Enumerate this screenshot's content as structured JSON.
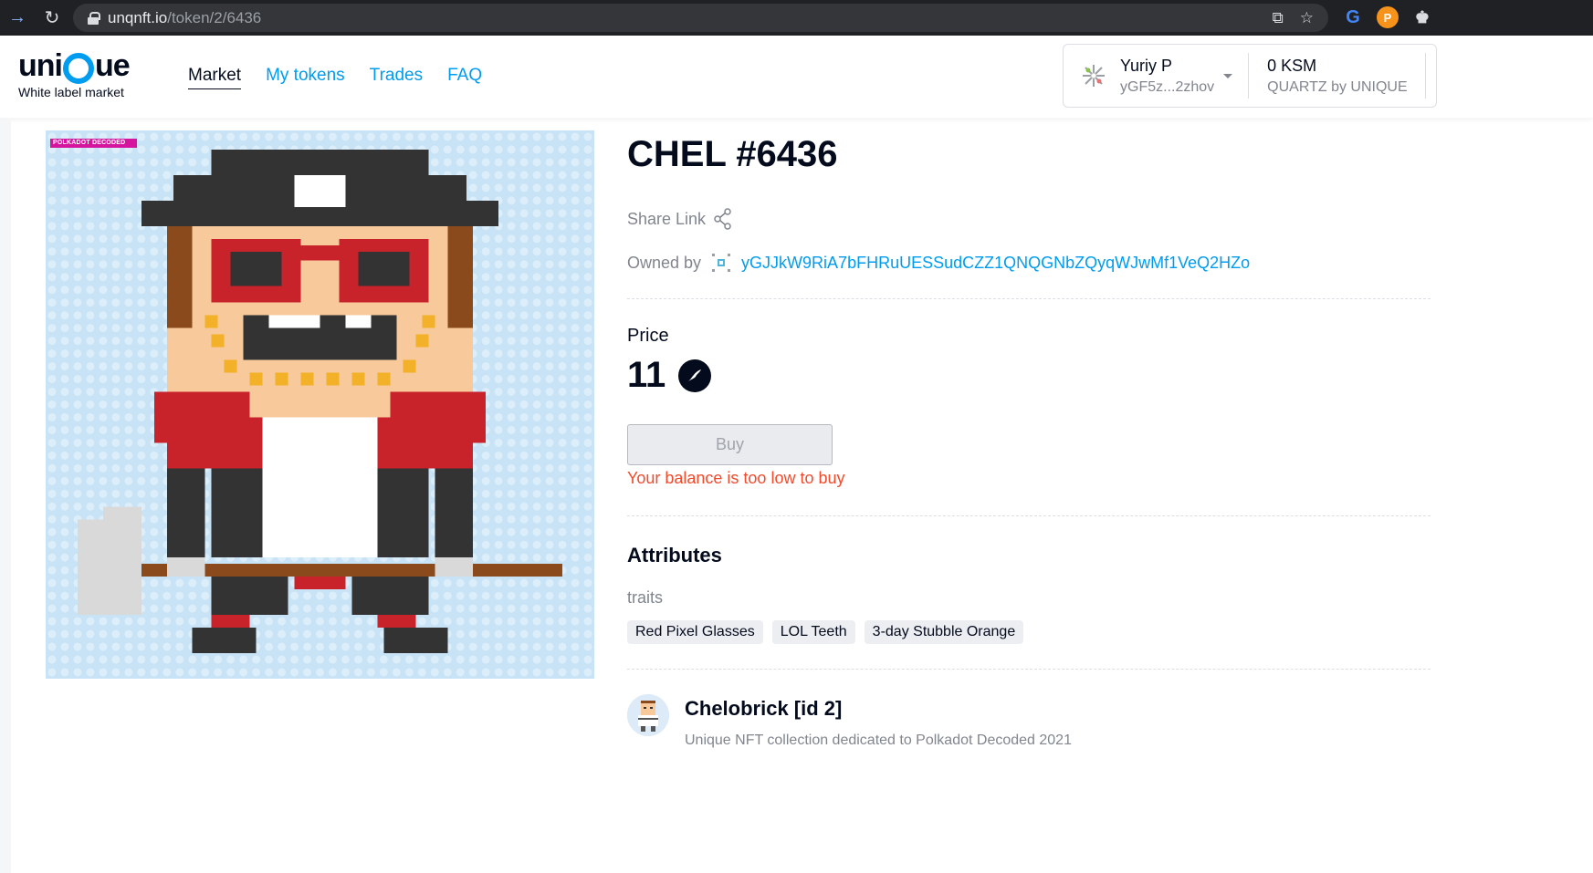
{
  "browser": {
    "url_host": "unqnft.io",
    "url_path": "/token/2/6436"
  },
  "header": {
    "logo_text_left": "uni",
    "logo_text_right": "ue",
    "logo_subtitle": "White label market",
    "nav": [
      {
        "label": "Market",
        "active": true
      },
      {
        "label": "My tokens",
        "active": false
      },
      {
        "label": "Trades",
        "active": false
      },
      {
        "label": "FAQ",
        "active": false
      }
    ],
    "account": {
      "name": "Yuriy P",
      "address": "yGF5z...2zhov",
      "balance": "0 KSM",
      "chain": "QUARTZ by UNIQUE"
    }
  },
  "token": {
    "badge": "POLKADOT DECODED",
    "title": "CHEL #6436",
    "share_label": "Share Link",
    "owned_label": "Owned by",
    "owner": "yGJJkW9RiA7bFHRuUESSudCZZ1QNQGNbZQyqWJwMf1VeQ2HZo",
    "price_label": "Price",
    "price_value": "11",
    "buy_label": "Buy",
    "warning": "Your balance is too low to buy",
    "attributes_title": "Attributes",
    "traits_label": "traits",
    "traits": [
      "Red Pixel Glasses",
      "LOL Teeth",
      "3-day Stubble Orange"
    ]
  },
  "collection": {
    "name": "Chelobrick [id 2]",
    "description": "Unique NFT collection dedicated to Polkadot Decoded 2021"
  },
  "colors": {
    "accent": "#009cf0",
    "warning": "#f34a2c",
    "text": "#040b1d",
    "muted": "#81858e"
  }
}
